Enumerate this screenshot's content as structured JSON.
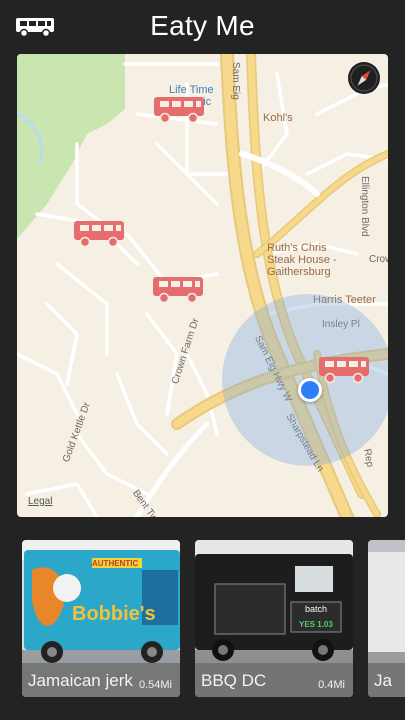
{
  "app": {
    "title": "Eaty Me",
    "logo_icon": "food-truck-icon"
  },
  "map": {
    "legal": "Legal",
    "compass_icon": "compass-icon",
    "pin_color": "#e56d6d",
    "user_dot_color": "#2d7ff9",
    "places": {
      "lifetime": "Life Time",
      "lifetime_2": "Athletic",
      "kohls": "Kohl's",
      "ruths_1": "Ruth's Chris",
      "ruths_2": "Steak House -",
      "ruths_3": "Gaithersburg",
      "harris": "Harris Teeter"
    },
    "streets": {
      "sam_eig_top": "Sam Eig",
      "ellington": "Ellington Blvd",
      "crow": "Crow",
      "insley": "Insley Pl",
      "sam_eig_hwy": "Sam Eig Hwy W",
      "crown_farm": "Crown Farm Dr",
      "gold_kettle": "Gold Kettle Dr",
      "sharpstead": "Sharpstead Ln",
      "bent_twig": "Bent Twig",
      "rep": "Rep"
    }
  },
  "trucks": [
    {
      "name": "Jamaican jerk",
      "distance": "0.54Mi",
      "photo_text": "Bobbie's",
      "photo_sub": "AUTHENTIC"
    },
    {
      "name": "BBQ DC",
      "distance": "0.4Mi",
      "photo_text": "batch",
      "photo_sub": "YES 1.03"
    },
    {
      "name": "Ja",
      "distance": "",
      "photo_text": "",
      "photo_sub": ""
    }
  ]
}
